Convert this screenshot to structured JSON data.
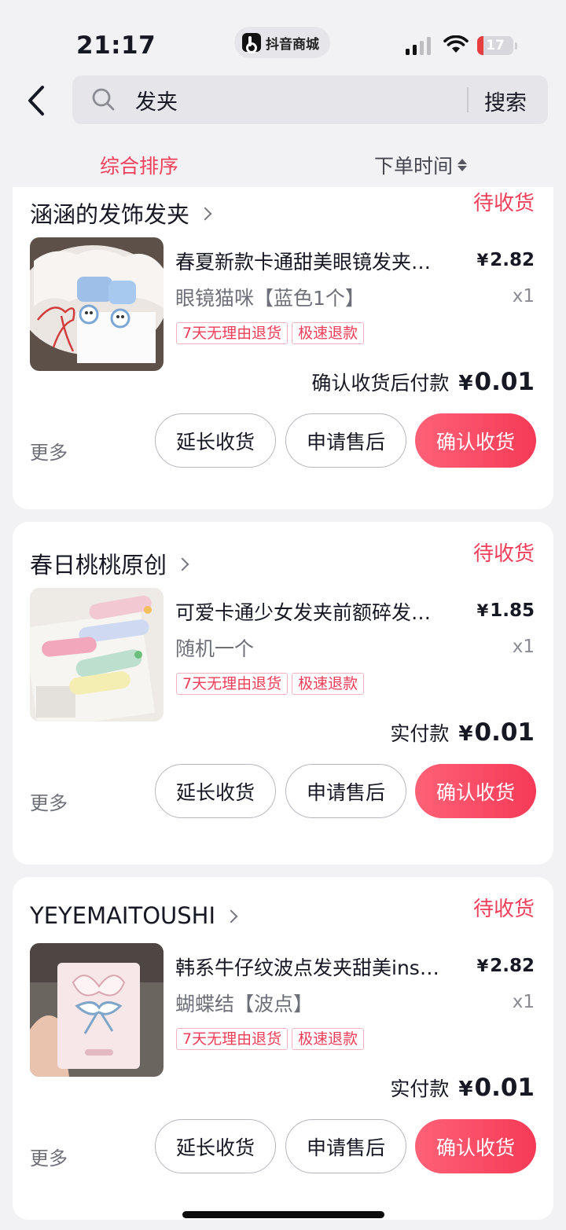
{
  "status_bar": {
    "time": "21:17",
    "app_name": "抖音商城",
    "battery": "17"
  },
  "header": {
    "search_value": "发夹",
    "search_button": "搜索"
  },
  "sort": {
    "comprehensive": "综合排序",
    "order_time": "下单时间"
  },
  "colors": {
    "accent": "#ef3f5b",
    "page_bg": "#f2f2f5"
  },
  "orders": [
    {
      "shop": "涵涵的发饰发夹",
      "status": "待收货",
      "title": "春夏新款卡通甜美眼镜发夹…",
      "variant": "眼镜猫咪【蓝色1个】",
      "price_symbol": "¥",
      "price": "2.82",
      "qty": "x1",
      "tags": [
        "7天无理由退货",
        "极速退款"
      ],
      "pay_label": "确认收货后付款",
      "pay_symbol": "¥",
      "pay_amount": "0.01",
      "more": "更多",
      "btn_extend": "延长收货",
      "btn_aftersale": "申请售后",
      "btn_confirm": "确认收货"
    },
    {
      "shop": "春日桃桃原创",
      "status": "待收货",
      "title": "可爱卡通少女发夹前额碎发…",
      "variant": "随机一个",
      "price_symbol": "¥",
      "price": "1.85",
      "qty": "x1",
      "tags": [
        "7天无理由退货",
        "极速退款"
      ],
      "pay_label": "实付款",
      "pay_symbol": "¥",
      "pay_amount": "0.01",
      "more": "更多",
      "btn_extend": "延长收货",
      "btn_aftersale": "申请售后",
      "btn_confirm": "确认收货"
    },
    {
      "shop": "YEYEMAITOUSHI",
      "status": "待收货",
      "title": "韩系牛仔纹波点发夹甜美ins…",
      "variant": "蝴蝶结【波点】",
      "price_symbol": "¥",
      "price": "2.82",
      "qty": "x1",
      "tags": [
        "7天无理由退货",
        "极速退款"
      ],
      "pay_label": "实付款",
      "pay_symbol": "¥",
      "pay_amount": "0.01",
      "more": "更多",
      "btn_extend": "延长收货",
      "btn_aftersale": "申请售后",
      "btn_confirm": "确认收货"
    }
  ]
}
